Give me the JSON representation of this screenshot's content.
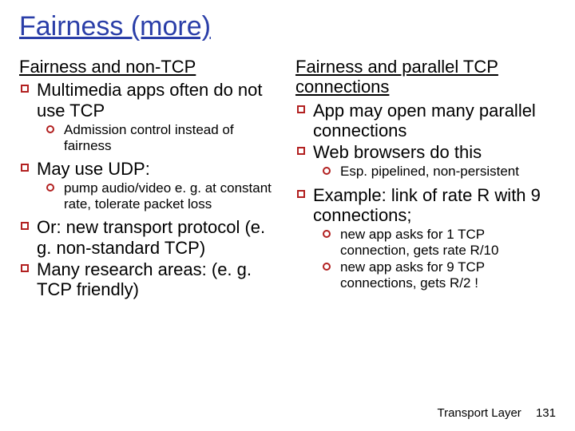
{
  "title": "Fairness (more)",
  "left": {
    "heading": "Fairness and non-TCP",
    "b1": "Multimedia apps often do not use TCP",
    "b1_s1": "Admission control instead of fairness",
    "b2": "May use UDP:",
    "b2_s1": "pump audio/video e. g. at constant rate, tolerate packet loss",
    "b3": "Or: new transport protocol (e. g. non-standard TCP)",
    "b4": "Many research areas: (e. g. TCP friendly)"
  },
  "right": {
    "heading": "Fairness and parallel TCP connections",
    "b1": "App may open many parallel connections",
    "b2": "Web browsers do this",
    "b2_s1": "Esp. pipelined, non-persistent",
    "b3": "Example: link of rate R with 9 connections;",
    "b3_s1": "new app asks for 1 TCP connection, gets rate R/10",
    "b3_s2": "new app asks for 9 TCP connections, gets R/2 !"
  },
  "footer": {
    "label": "Transport Layer",
    "page": "131"
  }
}
